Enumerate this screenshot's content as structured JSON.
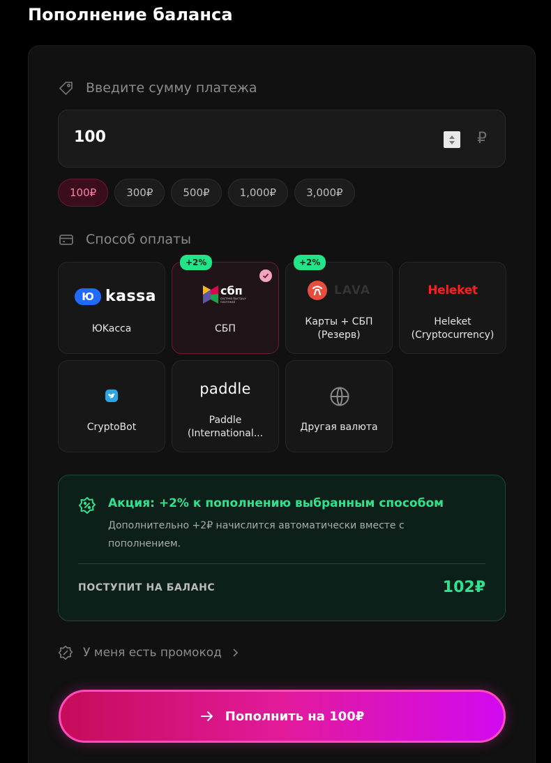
{
  "page": {
    "title": "Пополнение баланса"
  },
  "amount": {
    "label": "Введите сумму платежа",
    "value": "100",
    "currency": "₽",
    "presets": [
      "100₽",
      "300₽",
      "500₽",
      "1,000₽",
      "3,000₽"
    ],
    "selected_preset": "100₽"
  },
  "payment": {
    "label": "Способ оплаты",
    "methods": [
      {
        "name": "ЮKacca",
        "logo_text": "kassa",
        "logo_mark": "Ю"
      },
      {
        "name": "СБП",
        "logo_text": "сбп",
        "logo_sub": "система быстрых платежей",
        "badge": "+2%",
        "selected": true
      },
      {
        "name": "Карты + СБП (Резерв)",
        "logo_text": "LAVA",
        "badge": "+2%"
      },
      {
        "name": "Heleket (Cryptocurrency)",
        "logo_text": "Heleket"
      },
      {
        "name": "CryptoBot"
      },
      {
        "name": "Paddle (International...",
        "logo_text": "paddle"
      },
      {
        "name": "Другая валюта",
        "icon": "globe-icon"
      }
    ]
  },
  "promo": {
    "title": "Акция: +2% к пополнению выбранным способом",
    "text": "Дополнительно +2₽ начислится автоматически вместе с пополнением.",
    "total_label": "ПОСТУПИТ НА БАЛАНС",
    "total_value": "102₽"
  },
  "promocode": {
    "label": "У меня есть промокод"
  },
  "submit": {
    "label": "Пополнить на 100₽"
  },
  "colors": {
    "accent_green": "#2ee28f",
    "accent_pink": "#e21a9a",
    "background": "#000000",
    "card": "#111111"
  }
}
